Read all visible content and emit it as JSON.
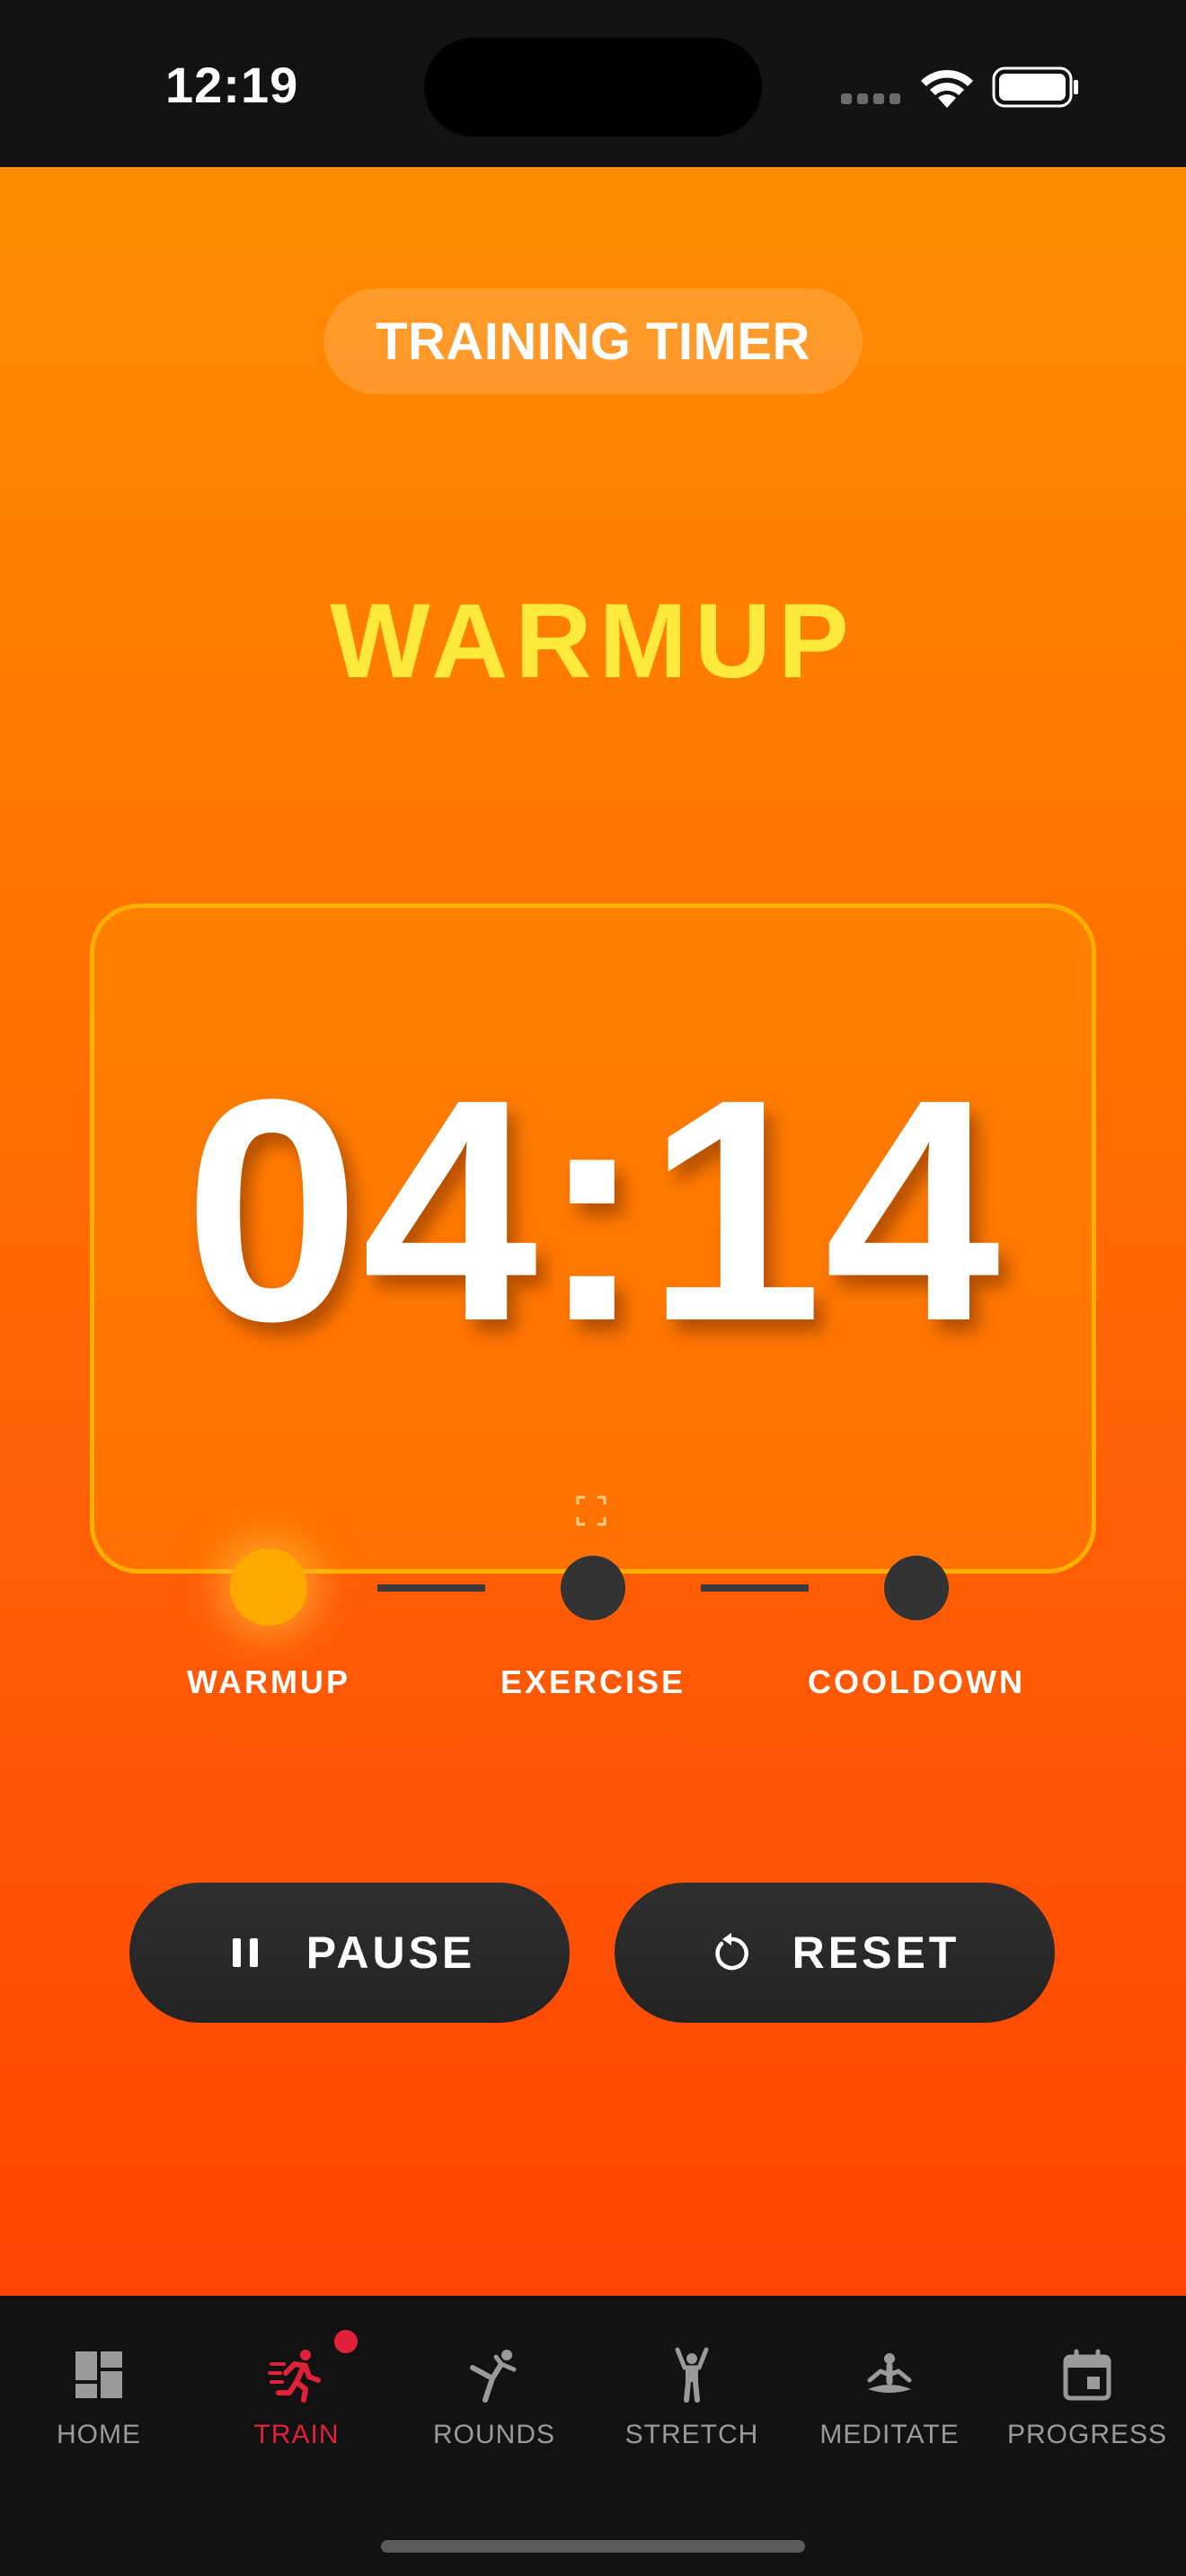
{
  "status_bar": {
    "time": "12:19"
  },
  "header": {
    "title": "TRAINING TIMER"
  },
  "phase": {
    "current": "WARMUP"
  },
  "timer": {
    "value": "04:14"
  },
  "phases": [
    {
      "label": "WARMUP",
      "active": true
    },
    {
      "label": "EXERCISE",
      "active": false
    },
    {
      "label": "COOLDOWN",
      "active": false
    }
  ],
  "controls": {
    "pause_label": "PAUSE",
    "reset_label": "RESET"
  },
  "tabs": [
    {
      "label": "HOME",
      "icon": "dashboard-icon"
    },
    {
      "label": "TRAIN",
      "icon": "running-icon",
      "active": true,
      "badge": true
    },
    {
      "label": "ROUNDS",
      "icon": "kick-icon"
    },
    {
      "label": "STRETCH",
      "icon": "stretch-icon"
    },
    {
      "label": "MEDITATE",
      "icon": "meditate-icon"
    },
    {
      "label": "PROGRESS",
      "icon": "calendar-icon"
    }
  ],
  "colors": {
    "gradient_top": "#ff8c00",
    "gradient_bottom": "#ff4504",
    "phase_heading": "#ffe93b",
    "card_border": "#ffb000",
    "active_dot": "#ffa800",
    "inactive_dot": "#333333",
    "button_bg": "#2a2a2a",
    "tab_active": "#e0213a",
    "tab_inactive": "#9a9a9a"
  }
}
